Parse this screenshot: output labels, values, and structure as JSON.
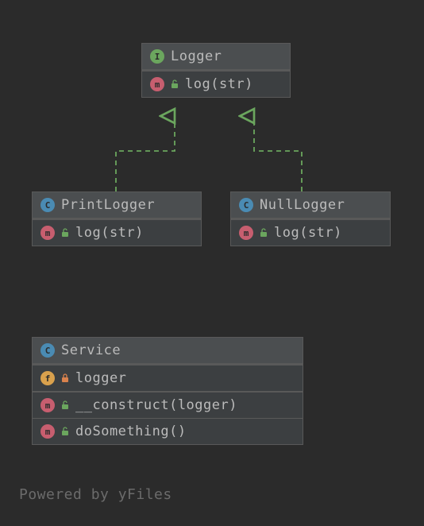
{
  "classes": {
    "logger": {
      "badge": "I",
      "name": "Logger",
      "members": [
        {
          "badge": "m",
          "lock": "green",
          "text": "log(str)"
        }
      ]
    },
    "printLogger": {
      "badge": "C",
      "name": "PrintLogger",
      "members": [
        {
          "badge": "m",
          "lock": "green",
          "text": "log(str)"
        }
      ]
    },
    "nullLogger": {
      "badge": "C",
      "name": "NullLogger",
      "members": [
        {
          "badge": "m",
          "lock": "green",
          "text": "log(str)"
        }
      ]
    },
    "service": {
      "badge": "C",
      "name": "Service",
      "members": [
        {
          "badge": "f",
          "lock": "red",
          "text": "logger"
        },
        {
          "badge": "m",
          "lock": "green",
          "text": "__construct(logger)"
        },
        {
          "badge": "m",
          "lock": "green",
          "text": "doSomething()"
        }
      ]
    }
  },
  "watermark": "Powered by yFiles",
  "colors": {
    "lockGreen": "#6ba65e",
    "lockRed": "#d9824d",
    "arrow": "#6ba65e"
  }
}
